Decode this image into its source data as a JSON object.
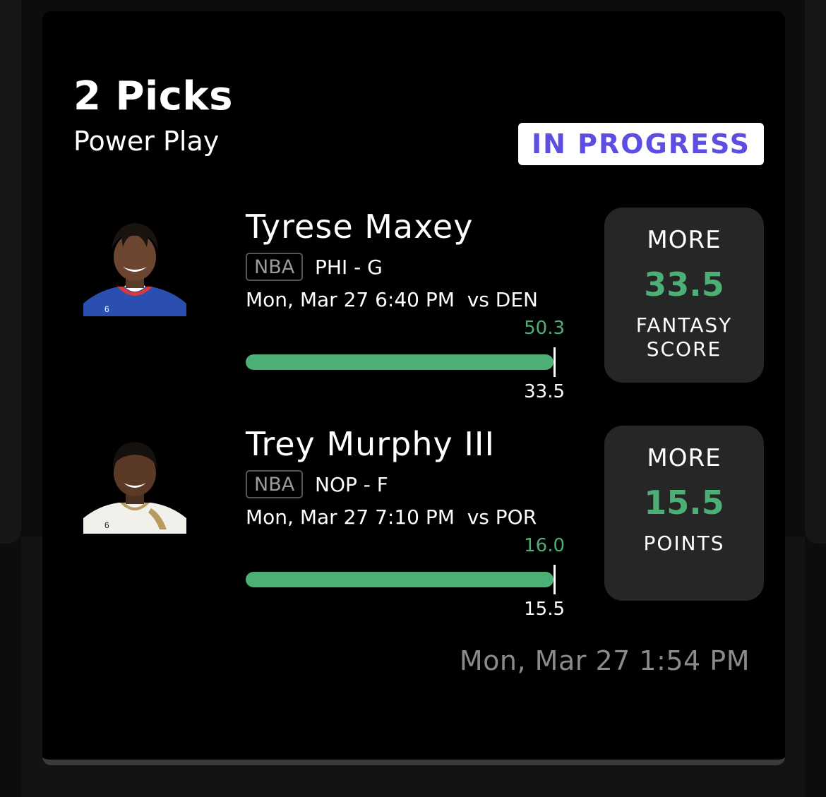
{
  "header": {
    "title": "2 Picks",
    "subtitle": "Power Play",
    "status": "IN PROGRESS"
  },
  "picks": [
    {
      "player": "Tyrese Maxey",
      "league": "NBA",
      "team_pos": "PHI - G",
      "game_time": "Mon, Mar 27 6:40 PM  vs DEN",
      "actual": "50.3",
      "line": "33.5",
      "progress": 1.0,
      "direction": "MORE",
      "projection": "33.5",
      "stat_line1": "FANTASY",
      "stat_line2": "SCORE"
    },
    {
      "player": "Trey Murphy III",
      "league": "NBA",
      "team_pos": "NOP - F",
      "game_time": "Mon, Mar 27 7:10 PM  vs POR",
      "actual": "16.0",
      "line": "15.5",
      "progress": 1.0,
      "direction": "MORE",
      "projection": "15.5",
      "stat_line1": "POINTS",
      "stat_line2": ""
    }
  ],
  "footer": {
    "timestamp": "Mon, Mar 27 1:54 PM"
  },
  "colors": {
    "accent_green": "#4caf76",
    "status_purple": "#5b4ee0",
    "card_bg": "#000000",
    "panel_bg": "#262626"
  }
}
